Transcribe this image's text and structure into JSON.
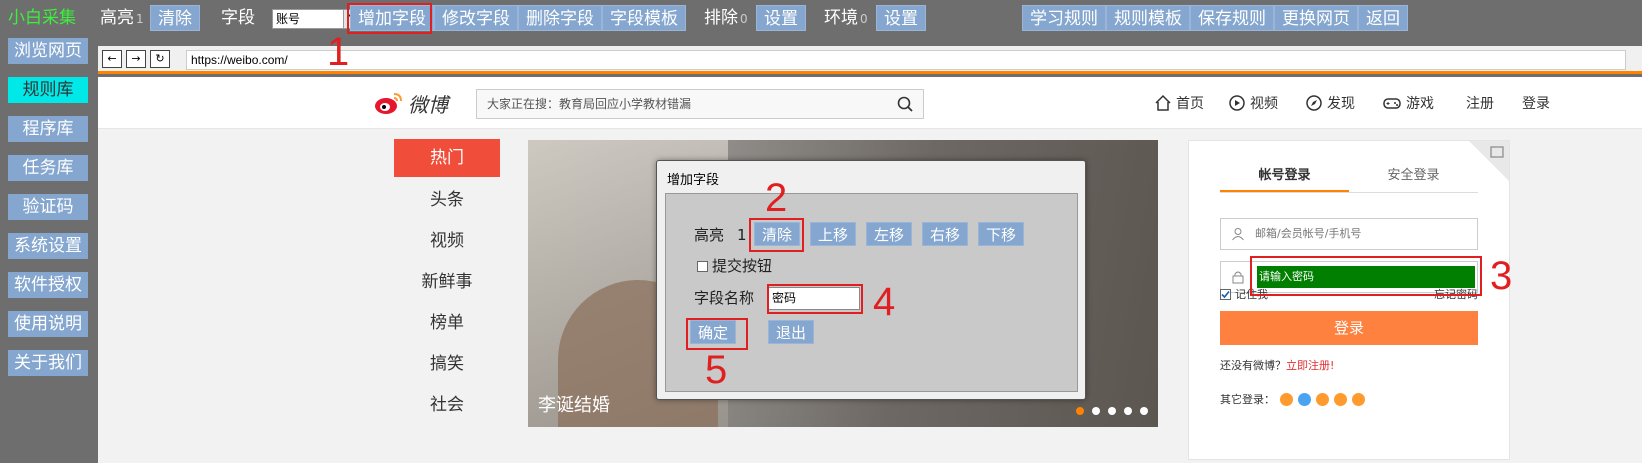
{
  "toolbar": {
    "brand": "小白采集",
    "highlight_label": "高亮",
    "highlight_count": "1",
    "clear": "清除",
    "field_label": "字段",
    "field_selected": "账号",
    "add_field": "增加字段",
    "edit_field": "修改字段",
    "delete_field": "删除字段",
    "field_template": "字段模板",
    "exclude_label": "排除",
    "exclude_count": "0",
    "exclude_settings": "设置",
    "env_label": "环境",
    "env_count": "0",
    "env_settings": "设置",
    "learn_rules": "学习规则",
    "rule_template": "规则模板",
    "save_rules": "保存规则",
    "change_page": "更换网页",
    "back": "返回"
  },
  "sidebar": {
    "items": [
      {
        "label": "浏览网页",
        "active": false
      },
      {
        "label": "规则库",
        "active": true
      },
      {
        "label": "程序库",
        "active": false
      },
      {
        "label": "任务库",
        "active": false
      },
      {
        "label": "验证码",
        "active": false
      },
      {
        "label": "系统设置",
        "active": false
      },
      {
        "label": "软件授权",
        "active": false
      },
      {
        "label": "使用说明",
        "active": false
      },
      {
        "label": "关于我们",
        "active": false
      }
    ]
  },
  "browser": {
    "back": "←",
    "forward": "→",
    "refresh": "↻",
    "url": "https://weibo.com/"
  },
  "weibo": {
    "logo_text": "微博",
    "search_placeholder": "大家正在搜：教育局回应小学教材错漏",
    "nav": {
      "home": "首页",
      "video": "视频",
      "discover": "发现",
      "game": "游戏",
      "register": "注册",
      "login": "登录"
    },
    "left_nav": [
      "热门",
      "头条",
      "视频",
      "新鲜事",
      "榜单",
      "搞笑",
      "社会"
    ],
    "banner_caption": "李诞结婚",
    "login_box": {
      "tab_account": "帐号登录",
      "tab_secure": "安全登录",
      "username_placeholder": "邮箱/会员帐号/手机号",
      "password_placeholder": "请输入密码",
      "remember": "记住我",
      "forgot": "忘记密码",
      "login_button": "登录",
      "no_account": "还没有微博？",
      "register_now": "立即注册!",
      "other_login": "其它登录："
    }
  },
  "dialog": {
    "title": "增加字段",
    "highlight_label": "高亮",
    "highlight_count": "1",
    "clear": "清除",
    "move_up": "上移",
    "move_left": "左移",
    "move_right": "右移",
    "move_down": "下移",
    "submit_checkbox": "提交按钮",
    "field_name_label": "字段名称",
    "field_name_value": "密码",
    "ok": "确定",
    "exit": "退出"
  },
  "annotations": [
    "1",
    "2",
    "3",
    "4",
    "5"
  ],
  "colors": {
    "toolbar_bg": "#6e6e6e",
    "button": "#84a6cf",
    "active_sidebar": "#00e8e8",
    "brand_green": "#3cf03c",
    "highlight_red": "#e02020",
    "weibo_orange": "#ff8200",
    "password_fill": "#007f00"
  }
}
